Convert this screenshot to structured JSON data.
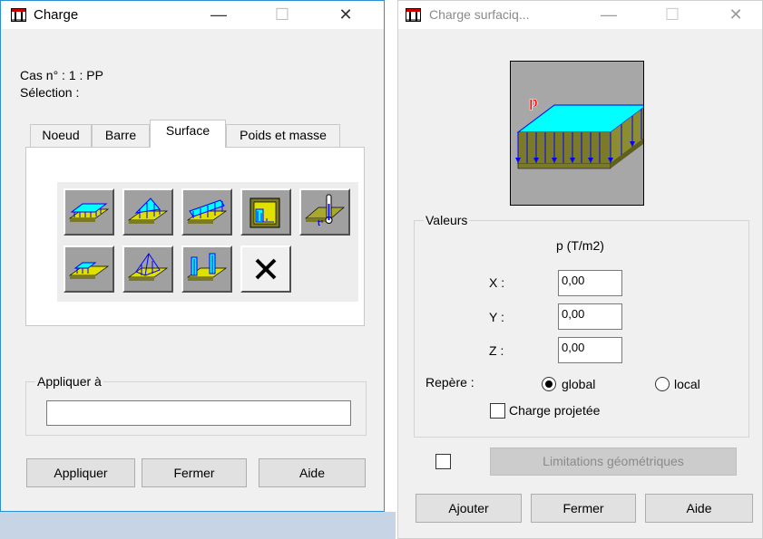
{
  "left_window": {
    "title": "Charge",
    "minimize_glyph": "—",
    "maximize_glyph": "☐",
    "close_glyph": "✕",
    "case_label": "Cas n° : 1 : PP",
    "selection_label": "Sélection :",
    "tabs": [
      {
        "label": "Noeud",
        "active": false
      },
      {
        "label": "Barre",
        "active": false
      },
      {
        "label": "Surface",
        "active": true
      },
      {
        "label": "Poids et masse",
        "active": false
      }
    ],
    "tools": [
      {
        "name": "uniform-surface-load-icon"
      },
      {
        "name": "hydrostatic-load-icon"
      },
      {
        "name": "linear-surface-load-icon"
      },
      {
        "name": "wall-pressure-load-icon"
      },
      {
        "name": "thermal-load-icon"
      },
      {
        "name": "partial-surface-load-icon"
      },
      {
        "name": "pyramid-load-icon"
      },
      {
        "name": "edge-load-icon"
      },
      {
        "name": "delete-load-icon"
      }
    ],
    "apply_to_label": "Appliquer à",
    "apply_to_value": "",
    "apply_button": "Appliquer",
    "close_button": "Fermer",
    "help_button": "Aide"
  },
  "right_window": {
    "title": "Charge surfaciq...",
    "minimize_glyph": "—",
    "maximize_glyph": "☐",
    "close_glyph": "✕",
    "preview_label": "p",
    "values_group": "Valeurs",
    "column_header": "p  (T/m2)",
    "x_label": "X :",
    "x_value": "0,00",
    "y_label": "Y :",
    "y_value": "0,00",
    "z_label": "Z :",
    "z_value": "0,00",
    "frame_label": "Repère :",
    "frame_options": [
      {
        "label": "global",
        "selected": true
      },
      {
        "label": "local",
        "selected": false
      }
    ],
    "projected_label": "Charge projetée",
    "projected_checked": false,
    "limits_checked": false,
    "limits_button": "Limitations géométriques",
    "add_button": "Ajouter",
    "close_button": "Fermer",
    "help_button": "Aide"
  },
  "colors": {
    "active_border": "#2b8fd6",
    "slab_top": "#00ffff",
    "slab_edge": "#7a7a28",
    "slab_base": "#ffff00",
    "load_arrows": "#0000ff",
    "label_red": "#ff0000"
  }
}
